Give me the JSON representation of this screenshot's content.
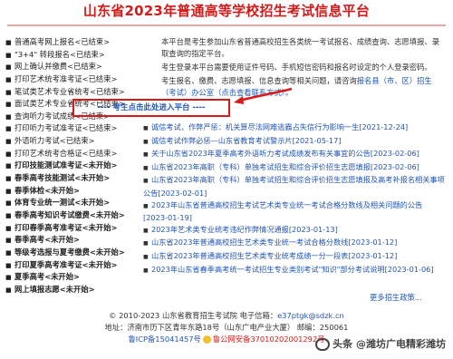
{
  "header": {
    "title": "山东省2023年普通高等学校招生考试信息平台"
  },
  "sidebar": {
    "items": [
      {
        "label": "普通高考网上报名<已结束>",
        "bold": false
      },
      {
        "label": "\"3+4\" 转段报名<已结束>",
        "bold": false
      },
      {
        "label": "网上确认并缴费<已结束>",
        "bold": false
      },
      {
        "label": "打印艺术统考准考证<已结束>",
        "bold": false
      },
      {
        "label": "笔试类艺术专业省统考<已结束>",
        "bold": false
      },
      {
        "label": "面试类艺术专业省统考<已结束>",
        "bold": false
      },
      {
        "label": "查询听力考试成绩<已结束>",
        "bold": false
      },
      {
        "label": "打印听力考试准考证<已结束>",
        "bold": false
      },
      {
        "label": "外语听力考试<已结束>",
        "bold": false
      },
      {
        "label": "打印艺术统考合格证<已结束>",
        "bold": false
      },
      {
        "label": "打印技能测试准考证<未开始>",
        "bold": true
      },
      {
        "label": "春季高考技能测试<未开始>",
        "bold": true
      },
      {
        "label": "春季体检<未开始>",
        "bold": true
      },
      {
        "label": "体育专业统一测试<未开始>",
        "bold": true
      },
      {
        "label": "春季高考知识考试缴费<未开始>",
        "bold": true
      },
      {
        "label": "打印春季高考准考证<未开始>",
        "bold": true
      },
      {
        "label": "春季高考<未开始>",
        "bold": true
      },
      {
        "label": "等级考选报与夏考缴费<未开始>",
        "bold": true
      },
      {
        "label": "打印夏季高考准考证<未开始>",
        "bold": true
      },
      {
        "label": "夏季高考<未开始>",
        "bold": true
      },
      {
        "label": "网上填报志愿<未开始>",
        "bold": true
      }
    ]
  },
  "notice": {
    "p1": "本平台是考生参加山东省普通高校招生各类统一考试报名、成绩查询、志愿填报、录取查询的指定平台。",
    "p2": "考生登录本平台需要使用证件号码、手机短信密码和报名时设定的个人登录密码。",
    "p3a": "考生报名、缴费、志愿填报、信息查询等相关问题，请咨询",
    "p3link": "报名县（市、区）招生（考试）办公室（点击查看联系方式）",
    "p3b": "。"
  },
  "enter_button": {
    "label": "---- 考生点击此处进入平台 ----"
  },
  "news": [
    "诚信考试，作弊严惩：机关算尽法网难逃霸占失信行为影响一生[2021-12-24]",
    "诚信考试作弊必惩—山东省教育考试警示片[2021-05-17]",
    "关于山东省2023年夏季高考外语听力考试成绩发布有关事宜的公告[2023-02-06]",
    "山东省2023年高职（专科）单独考试招生和综合评价招生志愿填报[2023-02-06]",
    "山东省2023年高职（专科）单独考试招生和综合评价招生志愿填报及高考补报名相关事项公告[2023-02-01]",
    "2023年山东省普通高校招生考试艺术类专业统一考试合格分数线及相关问题的公告[2023-01-19]",
    "2023年艺术类专业统考违纪作弊情况通报[2023-01-13]",
    "山东省2023年普通高校招生艺术类专业统一考试合格分数线[2023-01-12]",
    "山东省2023年普通高校招生艺术类专业统考成绩一分一段表[2023-01-12]",
    "2023年山东省春季高考统一考试招生专业类别考试\"知识\"部分考试说明[2023-01-06]"
  ],
  "more_link": "更多招生政策...",
  "footer": {
    "line1a": "© 2010-2023 山东省教育招生考试院 电子信箱：",
    "line1b": "e37ptgk@sdzk.cn",
    "line2": "地址：济南市历下区青年东路18号（山东广电产业大厦） 邮编：250061",
    "icp": "鲁ICP备15041457号",
    "record": "鲁公网安备37010202001292号"
  },
  "watermark": "头条 @潍坊广电精彩潍坊",
  "colors": {
    "title_red": "#d61a1a",
    "link_blue": "#2155b8"
  }
}
